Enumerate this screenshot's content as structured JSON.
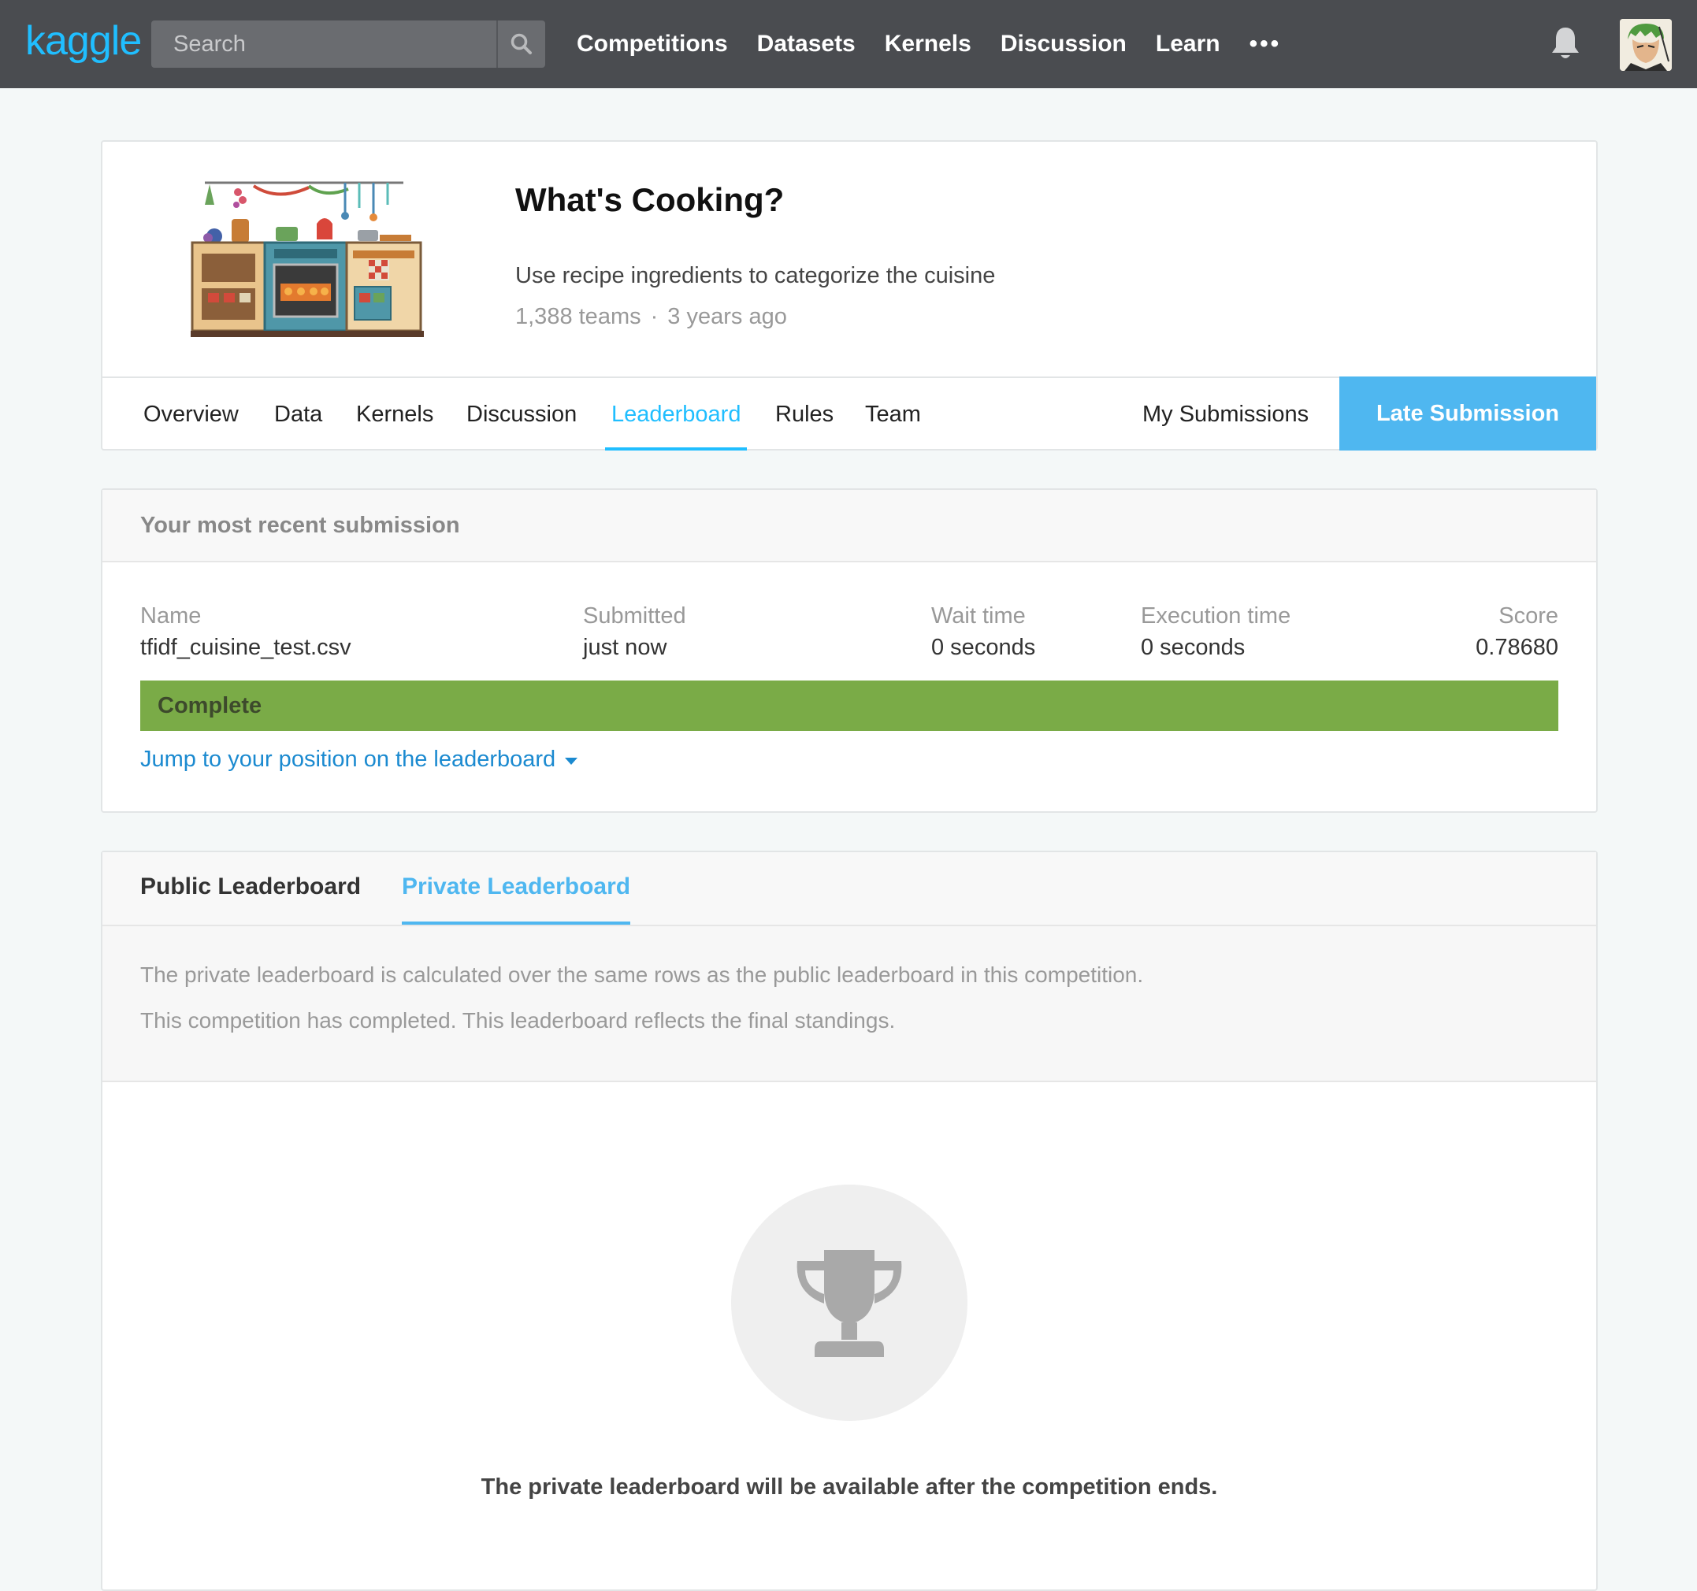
{
  "nav": {
    "logo": "kaggle",
    "search_placeholder": "Search",
    "links": [
      "Competitions",
      "Datasets",
      "Kernels",
      "Discussion",
      "Learn"
    ],
    "more": "•••"
  },
  "competition": {
    "title": "What's Cooking?",
    "description": "Use recipe ingredients to categorize the cuisine",
    "teams": "1,388 teams",
    "meta_sep": "·",
    "age": "3 years ago"
  },
  "tabs": {
    "overview": "Overview",
    "data": "Data",
    "kernels": "Kernels",
    "discussion": "Discussion",
    "leaderboard": "Leaderboard",
    "rules": "Rules",
    "team": "Team",
    "my_submissions": "My Submissions",
    "late_submission": "Late Submission",
    "active": "Leaderboard"
  },
  "submission": {
    "heading": "Your most recent submission",
    "labels": {
      "name": "Name",
      "submitted": "Submitted",
      "wait": "Wait time",
      "exec": "Execution time",
      "score": "Score"
    },
    "values": {
      "name": "tfidf_cuisine_test.csv",
      "submitted": "just now",
      "wait": "0 seconds",
      "exec": "0 seconds",
      "score": "0.78680"
    },
    "status": "Complete",
    "status_color": "#7aab47",
    "jump_link": "Jump to your position on the leaderboard"
  },
  "leaderboard": {
    "public_tab": "Public Leaderboard",
    "private_tab": "Private Leaderboard",
    "active": "Private Leaderboard",
    "info_line1": "The private leaderboard is calculated over the same rows as the public leaderboard in this competition.",
    "info_line2": "This competition has completed. This leaderboard reflects the final standings.",
    "empty_title": "The private leaderboard will be available after the competition ends."
  },
  "colors": {
    "accent": "#20beff",
    "nav_bg": "#4a4c50",
    "late_button": "#4fb7f0"
  }
}
